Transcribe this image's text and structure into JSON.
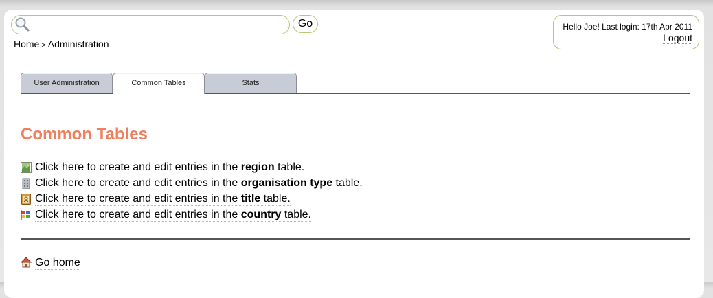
{
  "search": {
    "value": "",
    "placeholder": "",
    "go_label": "Go"
  },
  "breadcrumb": {
    "items": [
      "Home",
      "Administration"
    ],
    "separator": ">"
  },
  "user": {
    "greeting": "Hello Joe! Last login: 17th Apr 2011",
    "logout_label": "Logout"
  },
  "tabs": [
    {
      "label": "User Administration",
      "active": false
    },
    {
      "label": "Common Tables",
      "active": true
    },
    {
      "label": "Stats",
      "active": false
    }
  ],
  "main": {
    "title": "Common Tables",
    "links": [
      {
        "icon": "map-icon",
        "prefix": "Click here to create and edit entries in the",
        "keyword": "region",
        "suffix": "table."
      },
      {
        "icon": "building-icon",
        "prefix": "Click here to create and edit entries in the",
        "keyword": "organisation type",
        "suffix": "table."
      },
      {
        "icon": "address-book-icon",
        "prefix": "Click here to create and edit entries in the",
        "keyword": "title",
        "suffix": "table."
      },
      {
        "icon": "flag-icon",
        "prefix": "Click here to create and edit entries in the",
        "keyword": "country",
        "suffix": "table."
      }
    ],
    "home_link": {
      "icon": "home-icon",
      "label": "Go home"
    }
  },
  "colors": {
    "accent_title": "#ef7f5f",
    "field_border": "#b5c77a",
    "tab_inactive": "#c8ccd6",
    "divider": "#555555"
  }
}
